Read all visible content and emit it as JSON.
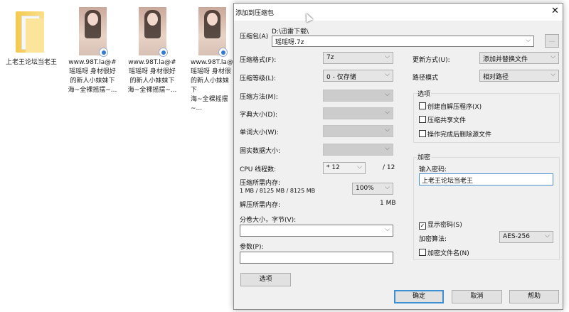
{
  "desktop": {
    "folder": {
      "label": "上老王论坛当老王"
    },
    "files": [
      {
        "lines": [
          "www.98T.la@#",
          "瑶瑶呀 身材很好",
          "的新人小妹妹下",
          "海~全裸摇摆~..."
        ]
      },
      {
        "lines": [
          "www.98T.la@#",
          "瑶瑶呀 身材很好",
          "的新人小妹妹下",
          "海~全裸摇摆~..."
        ]
      },
      {
        "lines": [
          "www.98T.la@",
          "瑶瑶呀 身材很",
          "的新人小妹妹下",
          "海~全裸摇摆~..."
        ]
      }
    ]
  },
  "dialog": {
    "title": "添加到压缩包",
    "close_icon": "close-icon",
    "archive": {
      "label": "压缩包(A)",
      "path": "D:\\迅雷下载\\",
      "value": "瑶瑶呀.7z",
      "browse_label": "..."
    },
    "format": {
      "label": "压缩格式(F):",
      "value": "7z"
    },
    "level": {
      "label": "压缩等级(L):",
      "value": "0 - 仅存储"
    },
    "method": {
      "label": "压缩方法(M):",
      "value": ""
    },
    "dict": {
      "label": "字典大小(D):",
      "value": ""
    },
    "word": {
      "label": "单词大小(W):",
      "value": ""
    },
    "solid": {
      "label": "固实数据大小:",
      "value": ""
    },
    "threads": {
      "label": "CPU 线程数:",
      "value": "* 12",
      "max": "/ 12"
    },
    "mem_compress": {
      "label": "压缩所需内存:",
      "detail": "1 MB / 8125 MB / 8125 MB",
      "value": "100%"
    },
    "mem_decompress": {
      "label": "解压所需内存:",
      "value": "1 MB"
    },
    "split": {
      "label": "分卷大小，字节(V):",
      "value": ""
    },
    "params": {
      "label": "参数(P):",
      "value": ""
    },
    "options_button": "选项",
    "update": {
      "label": "更新方式(U):",
      "value": "添加并替换文件"
    },
    "pathmode": {
      "label": "路径模式",
      "value": "相对路径"
    },
    "options_group": {
      "title": "选项",
      "items": [
        {
          "label": "创建自解压程序(X)",
          "checked": false
        },
        {
          "label": "压缩共享文件",
          "checked": false
        },
        {
          "label": "操作完成后删除源文件",
          "checked": false
        }
      ]
    },
    "encryption": {
      "title": "加密",
      "password_label": "输入密码:",
      "password": "上老王论坛当老王",
      "show_password": {
        "label": "显示密码(S)",
        "checked": true
      },
      "algo_label": "加密算法:",
      "algo": "AES-256",
      "encrypt_names": {
        "label": "加密文件名(N)",
        "checked": false
      }
    },
    "buttons": {
      "ok": "确定",
      "cancel": "取消",
      "help": "帮助"
    }
  }
}
